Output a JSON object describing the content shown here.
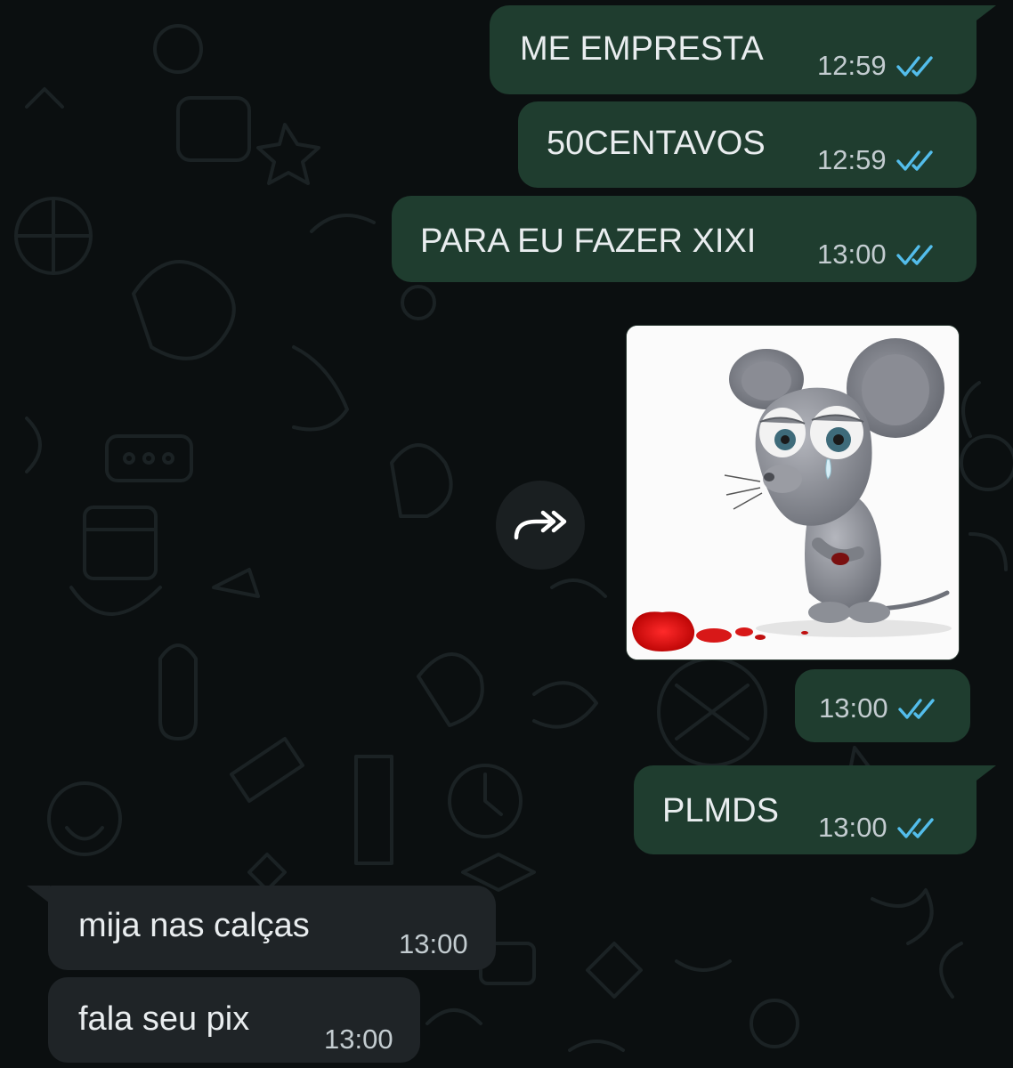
{
  "chat": {
    "messages": [
      {
        "text": "ME EMPRESTA",
        "time": "12:59",
        "status_icon": "double-check-read-icon"
      },
      {
        "text": "50CENTAVOS",
        "time": "12:59",
        "status_icon": "double-check-read-icon"
      },
      {
        "text": "PARA EU FAZER XIXI",
        "time": "13:00",
        "status_icon": "double-check-read-icon"
      },
      {
        "type": "image",
        "image_subject": "sad-crying-cartoon-mouse-sticker",
        "time": "13:00",
        "status_icon": "double-check-read-icon"
      },
      {
        "text": "PLMDS",
        "time": "13:00",
        "status_icon": "double-check-read-icon"
      },
      {
        "text": "mija nas calças",
        "time": "13:00"
      },
      {
        "text": "fala seu pix",
        "time": "13:00"
      }
    ],
    "forward_icon": "forward-arrow-icon"
  },
  "colors": {
    "background": "#0b0f10",
    "outgoing_bubble": "#1f3d2f",
    "incoming_bubble": "#1f2427",
    "read_ticks": "#53bdeb",
    "time_text": "#c3ccd0",
    "message_text": "#e9edef"
  }
}
